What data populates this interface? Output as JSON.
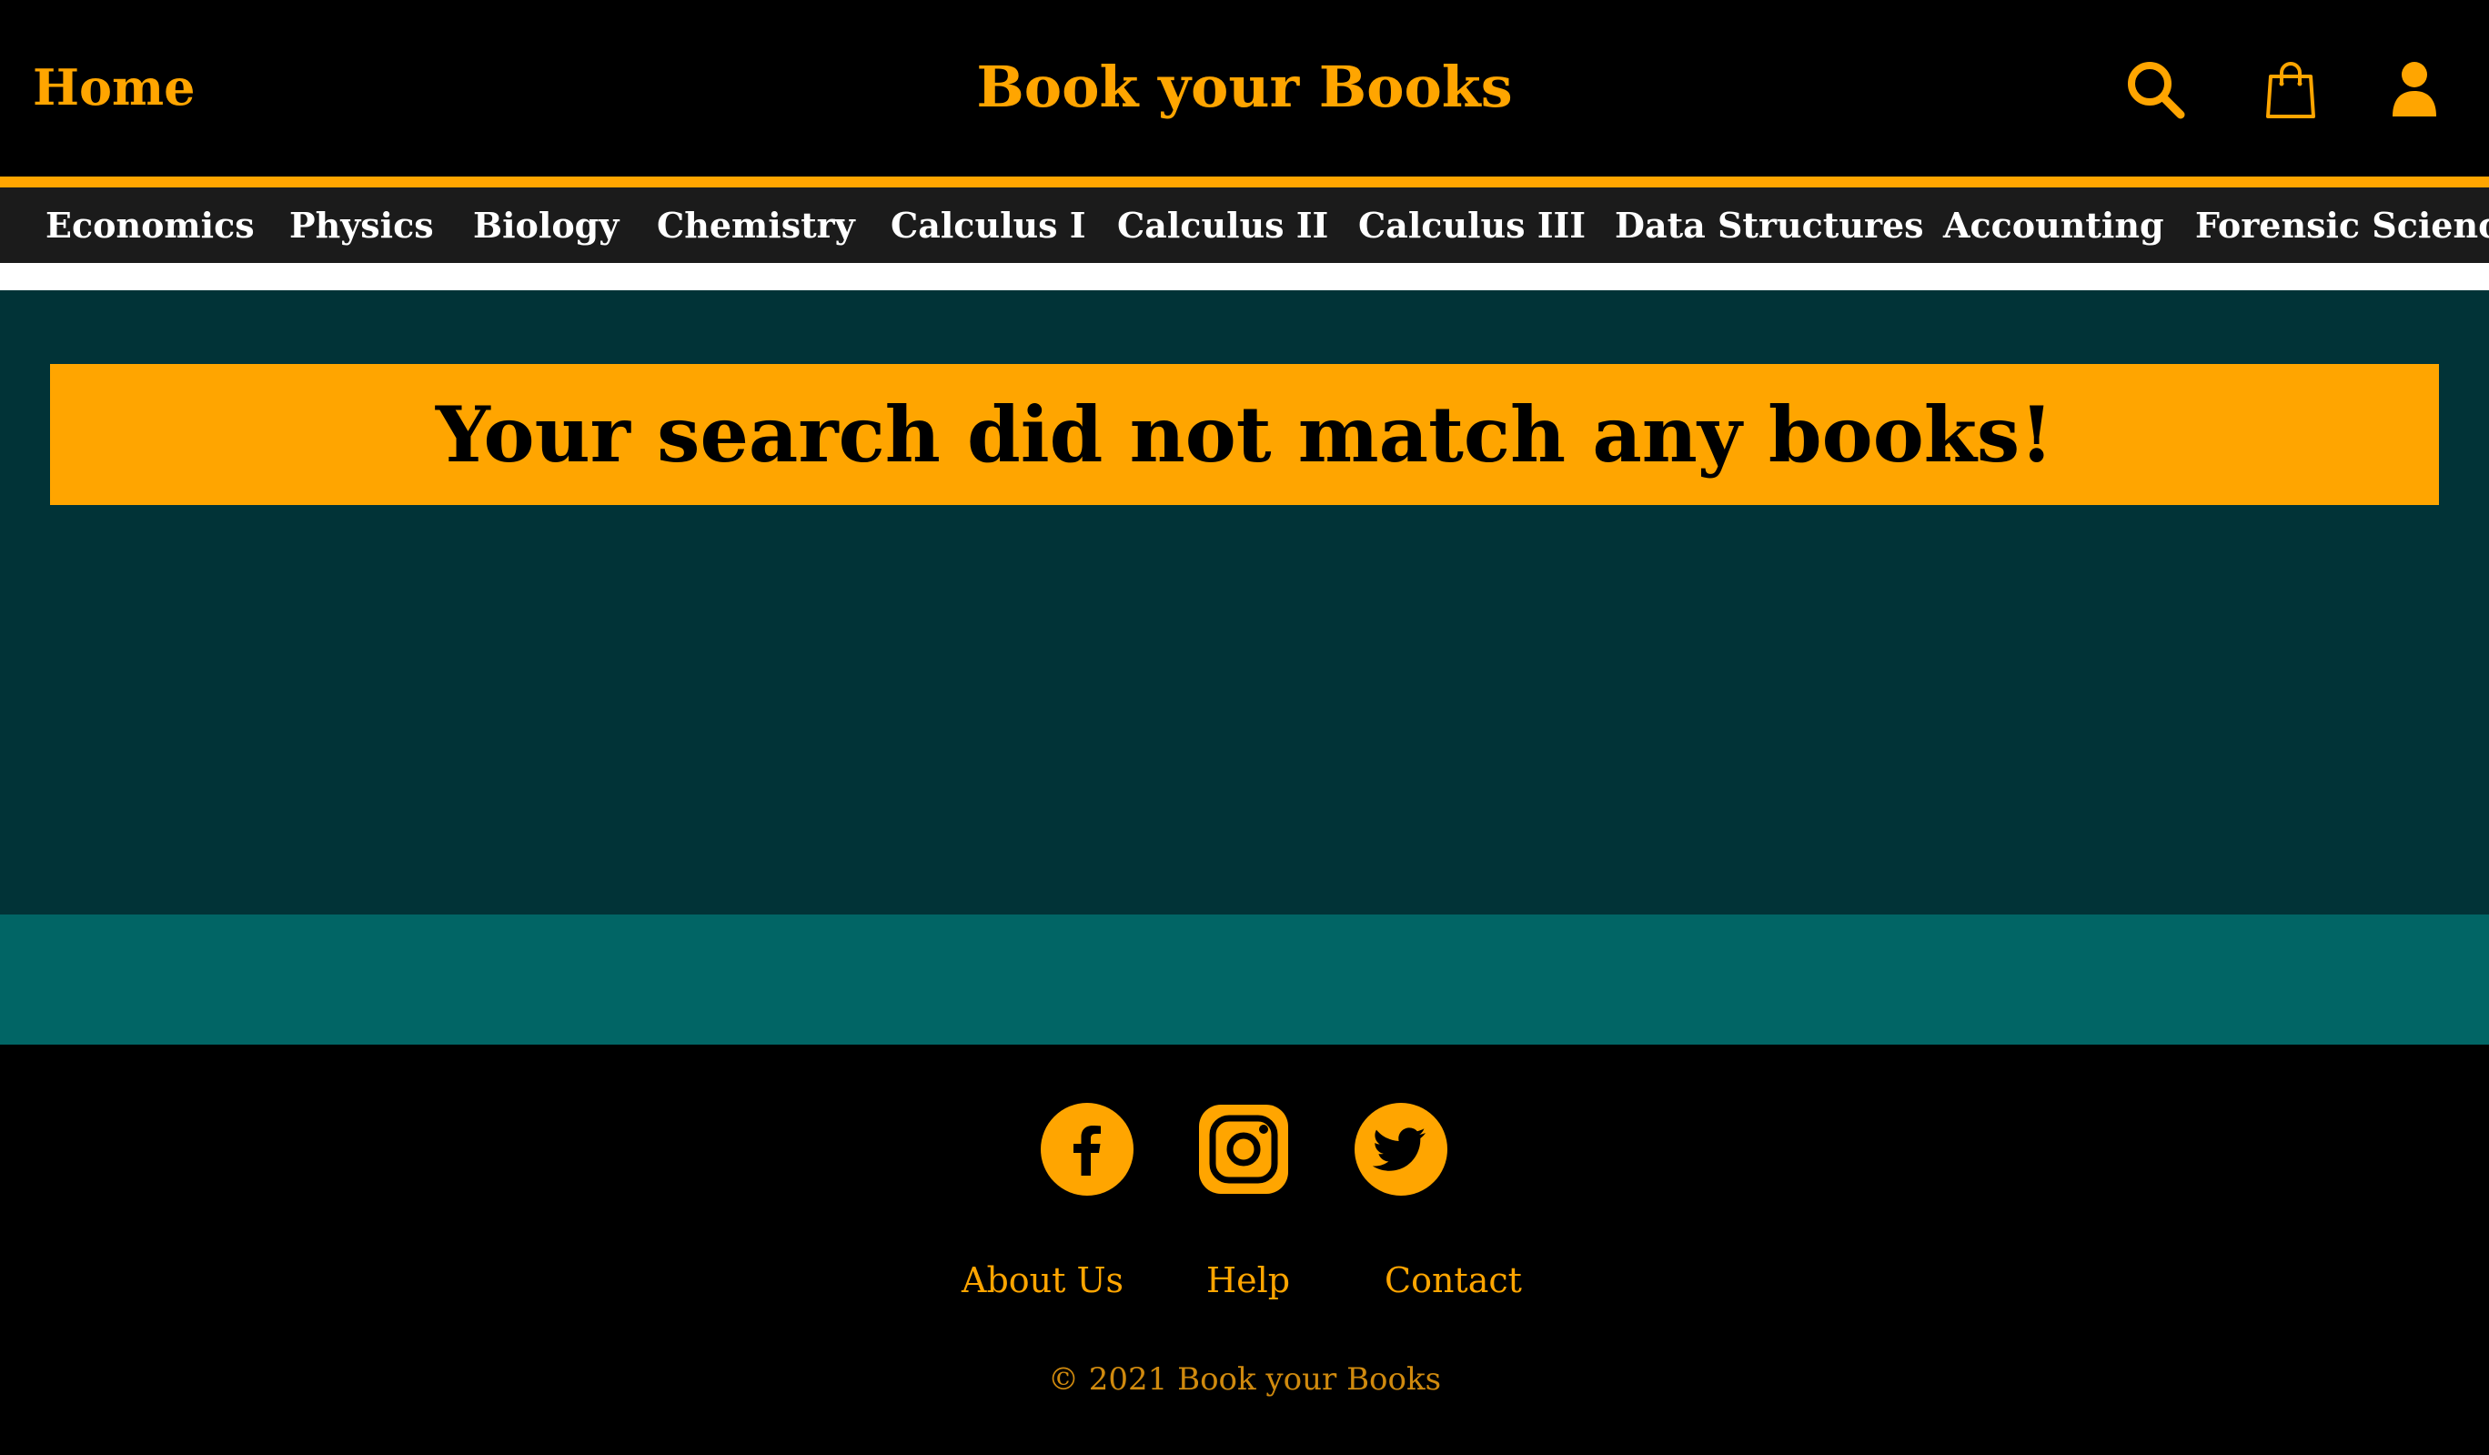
{
  "header": {
    "home_label": "Home",
    "brand": "Book your Books",
    "icons": [
      "search-icon",
      "shopping-bag-icon",
      "user-icon"
    ]
  },
  "categories": [
    "Economics",
    "Physics",
    "Biology",
    "Chemistry",
    "Calculus I",
    "Calculus II",
    "Calculus III",
    "Data Structures",
    "Accounting",
    "Forensic Science"
  ],
  "main": {
    "message": "Your search did not match any books!"
  },
  "footer": {
    "social_icons": [
      "facebook-icon",
      "instagram-icon",
      "twitter-icon"
    ],
    "links": [
      "About Us",
      "Help",
      "Contact"
    ],
    "copyright": "© 2021 Book your Books"
  },
  "colors": {
    "accent": "#FFA500",
    "header_bg": "#000000",
    "category_bar_bg": "#1B1B1B",
    "main_bg": "#013337",
    "band_bg": "#016565",
    "footer_bg": "#000000"
  }
}
